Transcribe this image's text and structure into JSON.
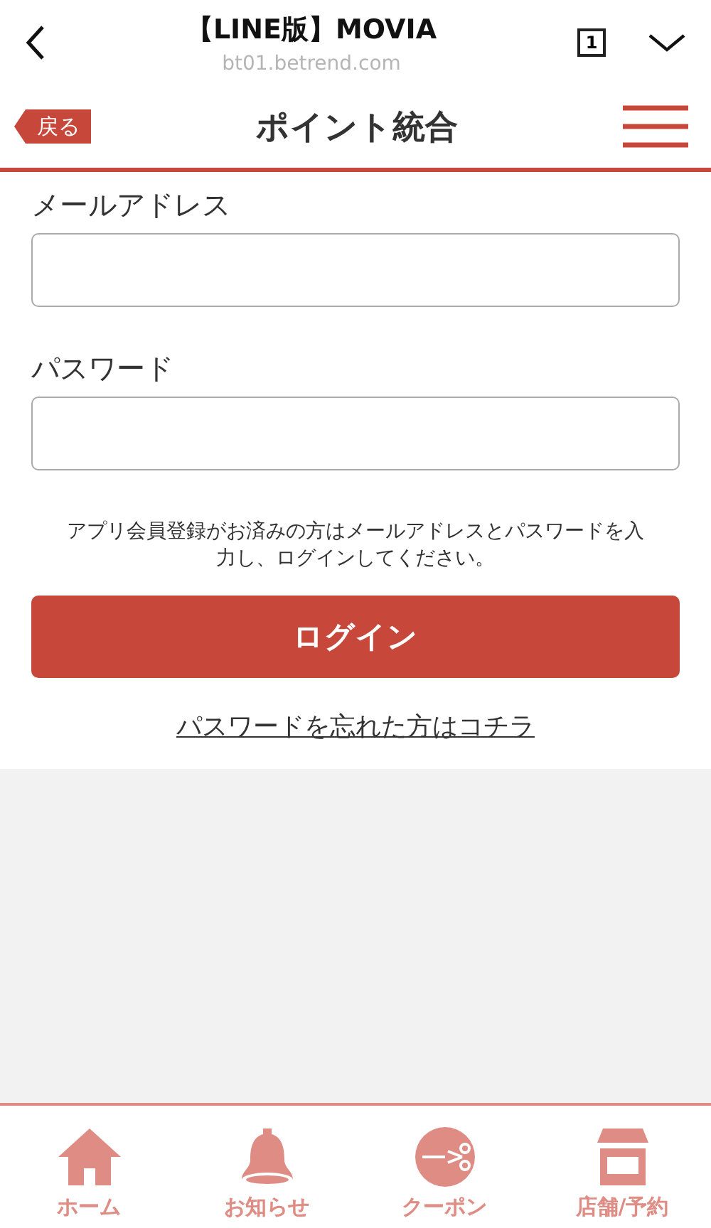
{
  "browser_bar": {
    "title": "【LINE版】MOVIA",
    "url": "bt01.betrend.com",
    "tab_count": "1"
  },
  "header": {
    "back": "戻る",
    "title": "ポイント統合"
  },
  "form": {
    "fields": [
      {
        "label": "メールアドレス"
      },
      {
        "label": "パスワード"
      }
    ],
    "note": "アプリ会員登録がお済みの方はメールアドレスとパスワードを入力し、ログインしてください。",
    "submit": "ログイン",
    "forgot_link": "パスワードを忘れた方はコチラ"
  },
  "bottom_nav": [
    {
      "kind": "home",
      "label": "ホーム"
    },
    {
      "kind": "bell",
      "label": "お知らせ"
    },
    {
      "kind": "coupon",
      "label": "クーポン"
    },
    {
      "kind": "shop",
      "label": "店舗/予約"
    }
  ]
}
